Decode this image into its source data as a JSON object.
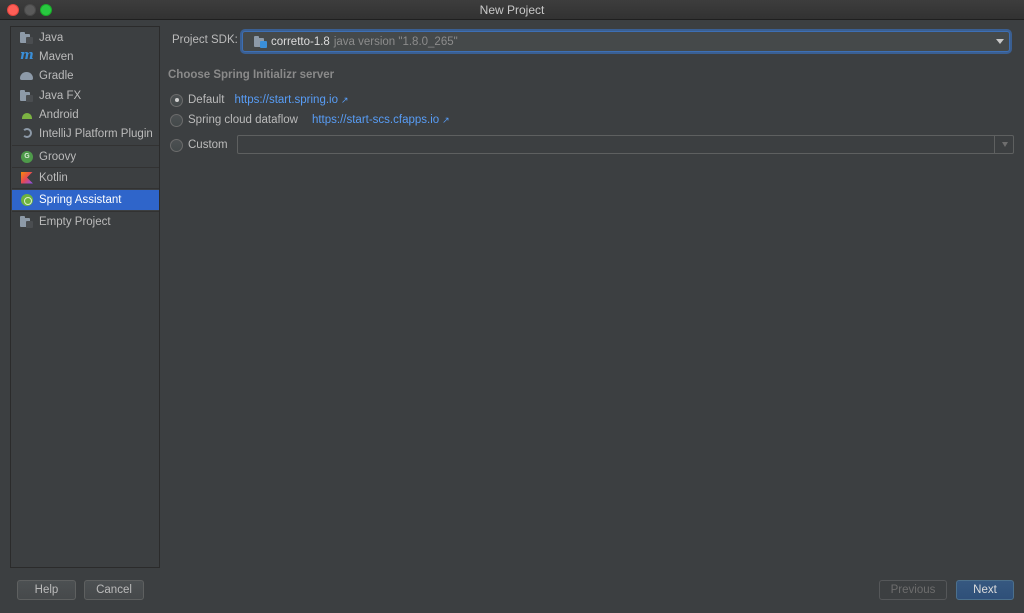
{
  "window": {
    "title": "New Project"
  },
  "sidebar": {
    "items": [
      {
        "label": "Java",
        "icon": "java-folder-icon"
      },
      {
        "label": "Maven",
        "icon": "maven-icon"
      },
      {
        "label": "Gradle",
        "icon": "gradle-icon"
      },
      {
        "label": "Java FX",
        "icon": "javafx-folder-icon"
      },
      {
        "label": "Android",
        "icon": "android-icon"
      },
      {
        "label": "IntelliJ Platform Plugin",
        "icon": "plugin-icon"
      },
      {
        "label": "Groovy",
        "icon": "groovy-icon"
      },
      {
        "label": "Kotlin",
        "icon": "kotlin-icon"
      },
      {
        "label": "Spring Assistant",
        "icon": "spring-icon",
        "selected": true
      },
      {
        "label": "Empty Project",
        "icon": "empty-project-folder-icon"
      }
    ]
  },
  "sdk": {
    "label": "Project SDK:",
    "name": "corretto-1.8",
    "version": "java version \"1.8.0_265\""
  },
  "server": {
    "section_title": "Choose Spring Initializr server",
    "options": [
      {
        "label": "Default",
        "url": "https://start.spring.io",
        "checked": true
      },
      {
        "label": "Spring cloud dataflow",
        "url": "https://start-scs.cfapps.io",
        "checked": false
      },
      {
        "label": "Custom",
        "value": "",
        "checked": false
      }
    ]
  },
  "buttons": {
    "help": "Help",
    "cancel": "Cancel",
    "previous": "Previous",
    "next": "Next"
  },
  "colors": {
    "background": "#3c3f41",
    "selection": "#2f65ca",
    "link": "#589df6",
    "primary_button": "#365880"
  }
}
